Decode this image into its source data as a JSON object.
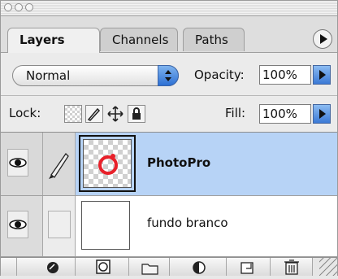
{
  "tabs": [
    "Layers",
    "Channels",
    "Paths"
  ],
  "blend_mode": "Normal",
  "opacity": {
    "label": "Opacity:",
    "value": "100%"
  },
  "lock_label": "Lock:",
  "fill": {
    "label": "Fill:",
    "value": "100%"
  },
  "layers": [
    {
      "name": "PhotoPro",
      "selected": true,
      "visible": true
    },
    {
      "name": "fundo branco",
      "selected": false,
      "visible": true
    }
  ],
  "icons": {
    "lock": [
      "lock-transparent-pixels-icon",
      "lock-image-pixels-icon",
      "lock-position-icon",
      "lock-all-icon"
    ],
    "bottom": [
      "layer-style-icon",
      "layer-mask-icon",
      "new-group-icon",
      "adjustment-layer-icon",
      "new-layer-icon",
      "trash-icon"
    ]
  },
  "colors": {
    "selection": "#b7d3f6",
    "accent_blue": "#3b79d6",
    "thumb_circle": "#e8202a"
  }
}
